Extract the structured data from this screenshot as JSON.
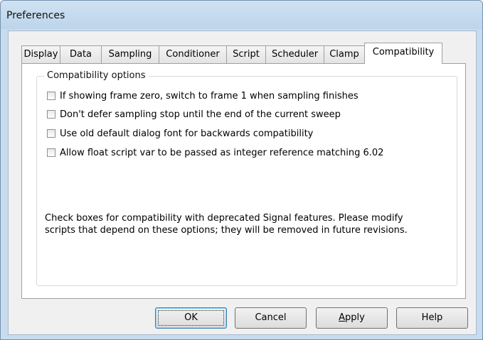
{
  "window": {
    "title": "Preferences"
  },
  "tabs": [
    {
      "label": "Display"
    },
    {
      "label": "Data"
    },
    {
      "label": "Sampling"
    },
    {
      "label": "Conditioner"
    },
    {
      "label": "Script"
    },
    {
      "label": "Scheduler"
    },
    {
      "label": "Clamp"
    },
    {
      "label": "Compatibility",
      "active": true
    }
  ],
  "group": {
    "title": "Compatibility options",
    "options": [
      {
        "label": "If showing frame zero, switch to frame 1 when sampling finishes",
        "checked": false
      },
      {
        "label": "Don't defer sampling stop until the end of the current sweep",
        "checked": false
      },
      {
        "label": "Use old default dialog font for backwards compatibility",
        "checked": false
      },
      {
        "label": "Allow float script var to be passed as integer reference matching 6.02",
        "checked": false
      }
    ],
    "note_line1": "Check boxes for compatibility with deprecated Signal features. Please modify",
    "note_line2": "scripts that depend on these options; they will be removed in future revisions."
  },
  "buttons": {
    "ok": "OK",
    "cancel": "Cancel",
    "apply_prefix": "A",
    "apply_rest": "pply",
    "help": "Help"
  }
}
